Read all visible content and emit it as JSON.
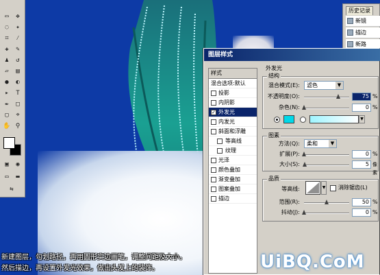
{
  "dialog": {
    "title": "图层样式",
    "style_list": {
      "header": "样式",
      "items": [
        {
          "label": "混合选项:默认",
          "checkbox": false
        },
        {
          "label": "投影",
          "checkbox": true,
          "checked": false
        },
        {
          "label": "内阴影",
          "checkbox": true,
          "checked": false
        },
        {
          "label": "外发光",
          "checkbox": true,
          "checked": true,
          "selected": true
        },
        {
          "label": "内发光",
          "checkbox": true,
          "checked": false
        },
        {
          "label": "斜面和浮雕",
          "checkbox": true,
          "checked": false
        },
        {
          "label": "等高线",
          "checkbox": true,
          "checked": false,
          "sub": true
        },
        {
          "label": "纹理",
          "checkbox": true,
          "checked": false,
          "sub": true
        },
        {
          "label": "光泽",
          "checkbox": true,
          "checked": false
        },
        {
          "label": "颜色叠加",
          "checkbox": true,
          "checked": false
        },
        {
          "label": "渐变叠加",
          "checkbox": true,
          "checked": false
        },
        {
          "label": "图案叠加",
          "checkbox": true,
          "checked": false
        },
        {
          "label": "描边",
          "checkbox": true,
          "checked": false
        }
      ]
    },
    "outer_glow": {
      "title": "外发光",
      "structure": {
        "title": "结构",
        "blend_mode_label": "混合模式(E):",
        "blend_mode_value": "滤色",
        "opacity_label": "不透明度(O):",
        "opacity_value": "75",
        "opacity_fraction": 0.75,
        "opacity_unit": "%",
        "noise_label": "杂色(N):",
        "noise_value": "0",
        "noise_fraction": 0,
        "noise_unit": "%",
        "glow_color": "#00d8e8"
      },
      "elements": {
        "title": "图素",
        "method_label": "方法(Q):",
        "method_value": "柔和",
        "spread_label": "扩展(P):",
        "spread_value": "0",
        "spread_fraction": 0,
        "spread_unit": "%",
        "size_label": "大小(S):",
        "size_value": "5",
        "size_fraction": 0.02,
        "size_unit": "像素"
      },
      "quality": {
        "title": "品质",
        "contour_label": "等高线:",
        "antialias_label": "消除锯齿(L)",
        "range_label": "范围(R):",
        "range_value": "50",
        "range_fraction": 0.5,
        "range_unit": "%",
        "jitter_label": "抖动(J):",
        "jitter_value": "0",
        "jitter_fraction": 0,
        "jitter_unit": "%"
      }
    }
  },
  "history": {
    "tab_label": "历史记录",
    "items": [
      "新镜",
      "描边",
      "新路"
    ]
  },
  "caption": {
    "line1": "新建图层，勾划路径，再用圆形实边画笔，调整间距及大小。",
    "line2": "然后描边，再设置外发光效果，做出头发上的装饰。"
  },
  "watermark": "UiBQ.CoM",
  "colors": {
    "canvas_bg": "#0d3aa6",
    "hair": "#1a8f8a",
    "glow": "#9ff5ff",
    "titlebar": "#0a246a"
  }
}
